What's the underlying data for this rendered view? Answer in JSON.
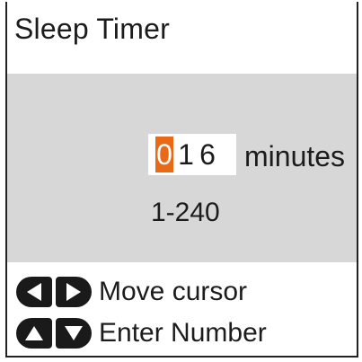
{
  "header": {
    "title": "Sleep Timer"
  },
  "timer": {
    "digits": [
      "0",
      "1",
      "6"
    ],
    "active_digit_index": 0,
    "unit": "minutes",
    "range": "1-240"
  },
  "legend": {
    "move_cursor": {
      "icons": [
        "left-arrow-key-icon",
        "right-arrow-key-icon"
      ],
      "label": "Move cursor"
    },
    "enter_number": {
      "icons": [
        "up-arrow-key-icon",
        "down-arrow-key-icon"
      ],
      "label": "Enter Number"
    }
  },
  "colors": {
    "panel_background": "#d7d7d7",
    "cursor_highlight": "#e86a17",
    "key_fill": "#1a1a1a"
  }
}
